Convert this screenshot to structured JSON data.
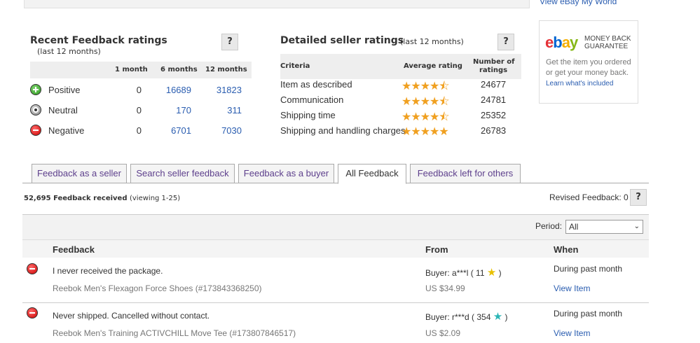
{
  "top_link": "View eBay My World",
  "recent": {
    "title": "Recent Feedback ratings",
    "sub": "(last 12 months)",
    "help": "?",
    "cols": [
      "1 month",
      "6 months",
      "12 months"
    ],
    "rows": [
      {
        "label": "Positive",
        "m1": "0",
        "m6": "16689",
        "m12": "31823"
      },
      {
        "label": "Neutral",
        "m1": "0",
        "m6": "170",
        "m12": "311"
      },
      {
        "label": "Negative",
        "m1": "0",
        "m6": "6701",
        "m12": "7030"
      }
    ]
  },
  "detailed": {
    "title": "Detailed seller ratings",
    "sub": "(last 12 months)",
    "help": "?",
    "col_criteria": "Criteria",
    "col_avg": "Average rating",
    "col_num1": "Number of",
    "col_num2": "ratings",
    "rows": [
      {
        "criteria": "Item as described",
        "stars": "★★★★⯪",
        "count": "24677"
      },
      {
        "criteria": "Communication",
        "stars": "★★★★⯪",
        "count": "24781"
      },
      {
        "criteria": "Shipping time",
        "stars": "★★★★⯪",
        "count": "25352"
      },
      {
        "criteria": "Shipping and handling charges",
        "stars": "★★★★★",
        "count": "26783"
      }
    ]
  },
  "mbg": {
    "logo_e": "e",
    "logo_b": "b",
    "logo_a": "a",
    "logo_y": "y",
    "line1": "MONEY BACK",
    "line2": "GUARANTEE",
    "text": "Get the item you ordered or get your money back.",
    "link": "Learn what's included"
  },
  "tabs": [
    "Feedback as a seller",
    "Search seller feedback",
    "Feedback as a buyer",
    "All Feedback",
    "Feedback left for others"
  ],
  "received": {
    "count": "52,695 Feedback received",
    "viewing": "(viewing 1-25)"
  },
  "revised": {
    "label": "Revised Feedback: 0",
    "help": "?"
  },
  "period": {
    "label": "Period:",
    "value": "All"
  },
  "table": {
    "col_feedback": "Feedback",
    "col_from": "From",
    "col_when": "When",
    "rows": [
      {
        "comment": "I never received the package.",
        "item": "Reebok Men's Flexagon Force Shoes (#173843368250)",
        "from": "Buyer: a***l ( 11",
        "close": ")",
        "price": "US $34.99",
        "when": "During past month",
        "view": "View Item"
      },
      {
        "comment": "Never shipped. Cancelled without contact.",
        "item": "Reebok Men's Training ACTIVCHILL Move Tee (#173807846517)",
        "from": "Buyer: r***d ( 354",
        "close": ")",
        "price": "US $2.09",
        "when": "During past month",
        "view": "View Item"
      }
    ]
  },
  "colors": {
    "link": "#2a5db0",
    "tab_text": "#5d3f8c",
    "star": "#f0a020"
  }
}
